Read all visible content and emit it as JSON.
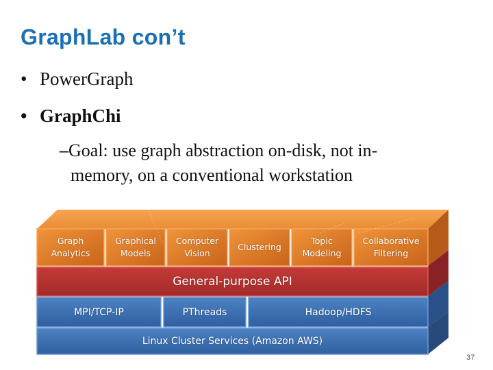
{
  "slide": {
    "title": "GraphLab con’t",
    "bullets": [
      {
        "marker": "•",
        "text": "PowerGraph",
        "bold": false
      },
      {
        "marker": "•",
        "text": "GraphChi",
        "bold": true
      }
    ],
    "sub_bullet": {
      "marker": "–",
      "text": "Goal: use graph abstraction on-disk, not in-memory, on a conventional workstation",
      "line1": "Goal: use graph abstraction on-disk, not in-",
      "line2": "memory, on a conventional workstation"
    },
    "page_number": "37"
  },
  "diagram": {
    "colors": {
      "app_layer": "#e8842a",
      "api_layer": "#b8302f",
      "runtime_layer": "#3f72b4",
      "infra_layer": "#3a6fb0"
    },
    "application_layer": [
      {
        "line1": "Graph",
        "line2": "Analytics"
      },
      {
        "line1": "Graphical",
        "line2": "Models"
      },
      {
        "line1": "Computer",
        "line2": "Vision"
      },
      {
        "line1": "Clustering",
        "line2": ""
      },
      {
        "line1": "Topic",
        "line2": "Modeling"
      },
      {
        "line1": "Collaborative",
        "line2": "Filtering"
      }
    ],
    "api_layer": "General-purpose API",
    "runtime_layer": [
      "MPI/TCP-IP",
      "PThreads",
      "Hadoop/HDFS"
    ],
    "infrastructure_layer": "Linux Cluster Services (Amazon AWS)"
  }
}
